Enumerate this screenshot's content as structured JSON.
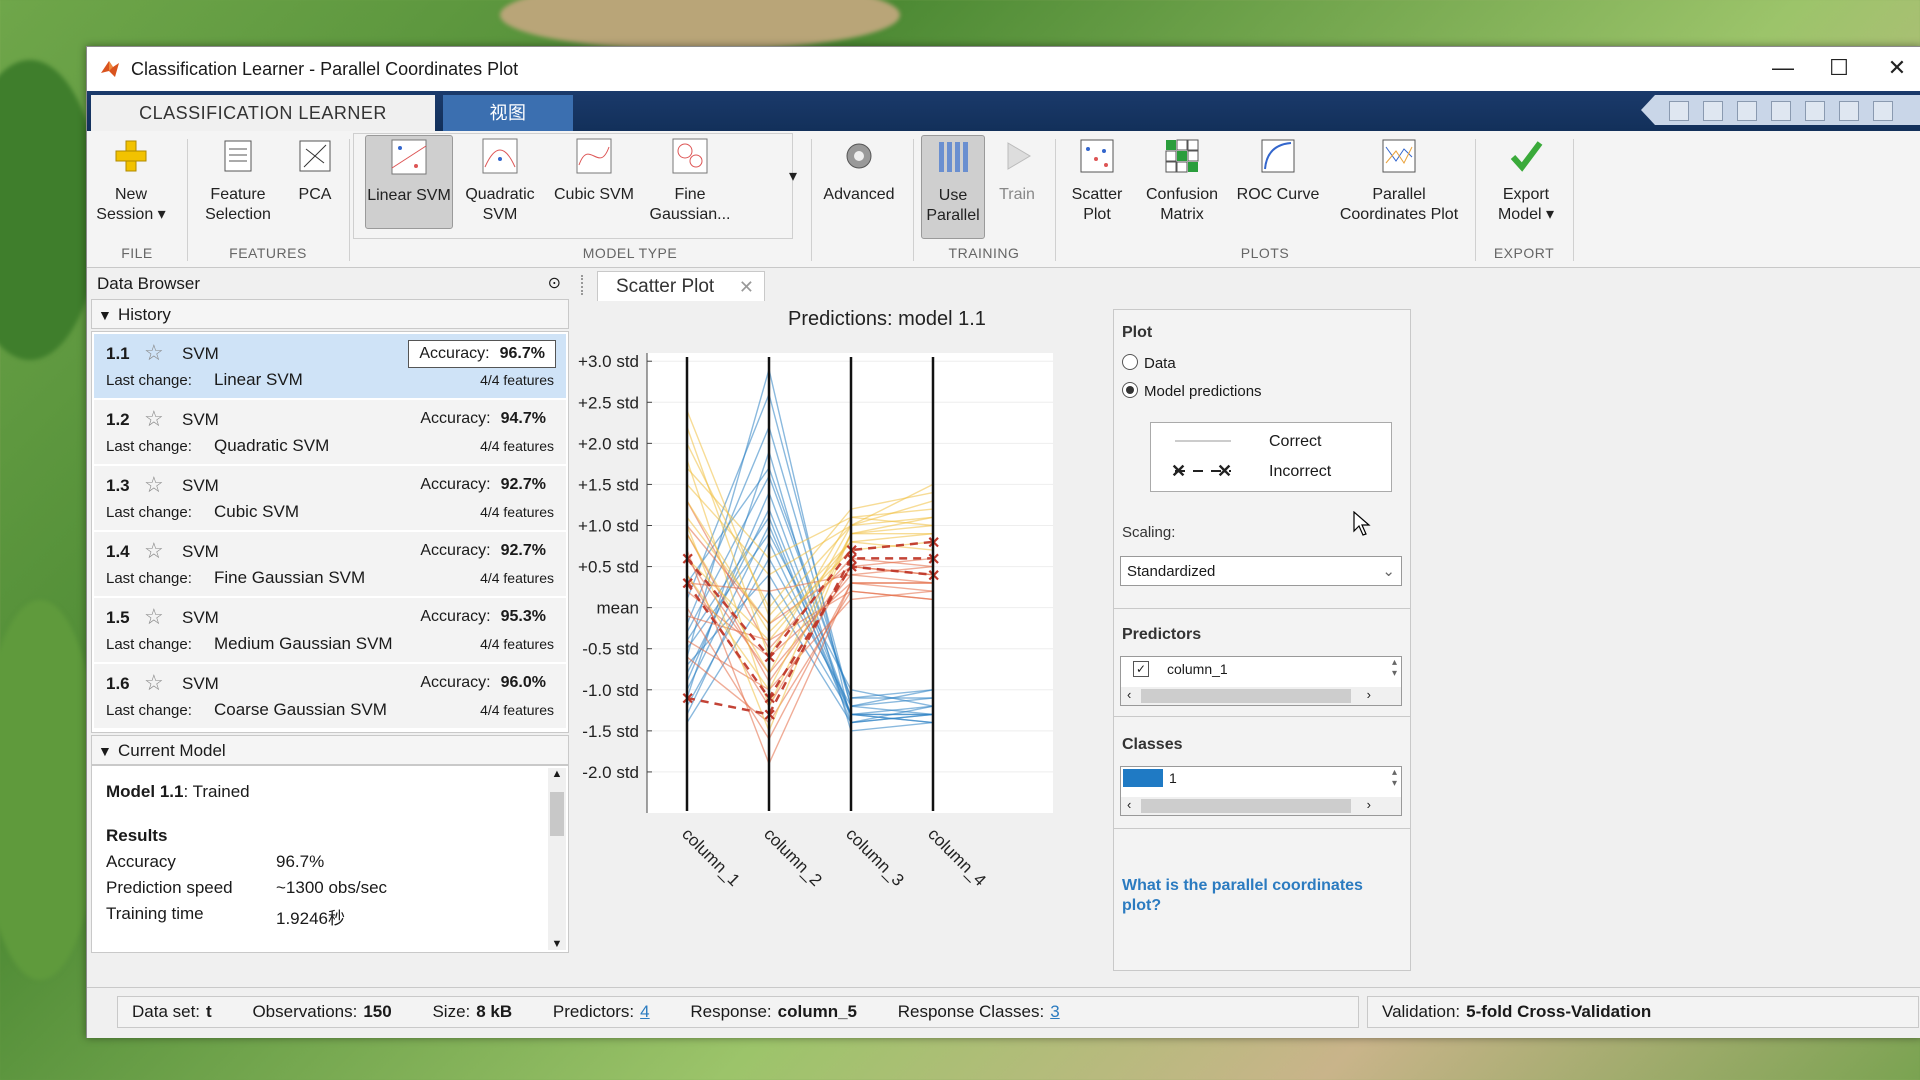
{
  "window": {
    "title": "Classification Learner - Parallel Coordinates Plot"
  },
  "ribbon_tabs": {
    "active": "CLASSIFICATION LEARNER",
    "inactive": "视图"
  },
  "ribbon": {
    "new_session": [
      "New",
      "Session"
    ],
    "feature_selection": [
      "Feature",
      "Selection"
    ],
    "pca": "PCA",
    "linear_svm": "Linear SVM",
    "quadratic_svm": [
      "Quadratic",
      "SVM"
    ],
    "cubic_svm": "Cubic SVM",
    "fine_gaussian": [
      "Fine",
      "Gaussian..."
    ],
    "advanced": "Advanced",
    "use_parallel": [
      "Use",
      "Parallel"
    ],
    "train": "Train",
    "scatter_plot": [
      "Scatter",
      "Plot"
    ],
    "confusion_matrix": [
      "Confusion",
      "Matrix"
    ],
    "roc_curve": "ROC Curve",
    "parallel_coords": [
      "Parallel",
      "Coordinates Plot"
    ],
    "export_model": [
      "Export",
      "Model"
    ],
    "groups": {
      "file": "FILE",
      "features": "FEATURES",
      "model_type": "MODEL TYPE",
      "training": "TRAINING",
      "plots": "PLOTS",
      "export": "EXPORT"
    }
  },
  "data_browser": {
    "title": "Data Browser",
    "history_label": "History",
    "current_model_label": "Current Model"
  },
  "history": [
    {
      "num": "1.1",
      "type": "SVM",
      "acc_label": "Accuracy:",
      "acc": "96.7%",
      "lc_label": "Last change:",
      "lc": "Linear SVM",
      "features": "4/4 features"
    },
    {
      "num": "1.2",
      "type": "SVM",
      "acc_label": "Accuracy:",
      "acc": "94.7%",
      "lc_label": "Last change:",
      "lc": "Quadratic SVM",
      "features": "4/4 features"
    },
    {
      "num": "1.3",
      "type": "SVM",
      "acc_label": "Accuracy:",
      "acc": "92.7%",
      "lc_label": "Last change:",
      "lc": "Cubic SVM",
      "features": "4/4 features"
    },
    {
      "num": "1.4",
      "type": "SVM",
      "acc_label": "Accuracy:",
      "acc": "92.7%",
      "lc_label": "Last change:",
      "lc": "Fine Gaussian SVM",
      "features": "4/4 features"
    },
    {
      "num": "1.5",
      "type": "SVM",
      "acc_label": "Accuracy:",
      "acc": "95.3%",
      "lc_label": "Last change:",
      "lc": "Medium Gaussian SVM",
      "features": "4/4 features"
    },
    {
      "num": "1.6",
      "type": "SVM",
      "acc_label": "Accuracy:",
      "acc": "96.0%",
      "lc_label": "Last change:",
      "lc": "Coarse Gaussian SVM",
      "features": "4/4 features"
    }
  ],
  "current_model": {
    "model_name": "Model 1.1",
    "model_status": ": Trained",
    "results_label": "Results",
    "rows": [
      {
        "k": "Accuracy",
        "v": "96.7%"
      },
      {
        "k": "Prediction speed",
        "v": "~1300 obs/sec"
      },
      {
        "k": "Training time",
        "v": "1.9246秒"
      }
    ]
  },
  "doc_tab": "Scatter Plot",
  "options": {
    "plot_label": "Plot",
    "radio_data": "Data",
    "radio_predictions": "Model predictions",
    "legend_correct": "Correct",
    "legend_incorrect": "Incorrect",
    "scaling_label": "Scaling:",
    "scaling_value": "Standardized",
    "predictors_label": "Predictors",
    "predictor_item": "column_1",
    "classes_label": "Classes",
    "class_item": "1",
    "help_link": "What is the parallel coordinates plot?"
  },
  "status": {
    "dataset_label": "Data set:",
    "dataset": "t",
    "obs_label": "Observations:",
    "obs": "150",
    "size_label": "Size:",
    "size": "8 kB",
    "pred_label": "Predictors:",
    "pred": "4",
    "resp_label": "Response:",
    "resp": "column_5",
    "rclass_label": "Response Classes:",
    "rclass": "3",
    "validation_label": "Validation:",
    "validation": "5-fold Cross-Validation"
  },
  "colors": {
    "class1": "#2a7fc2",
    "class2": "#e46a44",
    "class3": "#f0c040",
    "incorrect": "#c0392b"
  },
  "chart_data": {
    "type": "parallel_coordinates",
    "title": "Predictions: model 1.1",
    "axes": [
      "column_1",
      "column_2",
      "column_3",
      "column_4"
    ],
    "ytick_labels": [
      "+3.0 std",
      "+2.5 std",
      "+2.0 std",
      "+1.5 std",
      "+1.0 std",
      "+0.5 std",
      "mean",
      "-0.5 std",
      "-1.0 std",
      "-1.5 std",
      "-2.0 std"
    ],
    "ylim": [
      -2.5,
      3.1
    ],
    "series": [
      {
        "class": "blue",
        "color": "#2a7fc2",
        "lines": [
          [
            -1.0,
            1.0,
            -1.3,
            -1.3
          ],
          [
            -0.6,
            2.9,
            -1.4,
            -1.2
          ],
          [
            -1.2,
            0.6,
            -1.2,
            -1.3
          ],
          [
            -0.3,
            1.6,
            -1.1,
            -1.0
          ],
          [
            -0.8,
            1.2,
            -1.3,
            -1.4
          ],
          [
            -1.4,
            0.2,
            -1.4,
            -1.3
          ],
          [
            -0.2,
            2.2,
            -1.2,
            -1.1
          ],
          [
            -0.9,
            1.4,
            -1.3,
            -1.3
          ],
          [
            -0.5,
            0.9,
            -1.0,
            -1.2
          ],
          [
            -1.1,
            1.9,
            -1.5,
            -1.4
          ],
          [
            0.1,
            2.6,
            -1.2,
            -1.0
          ],
          [
            -0.7,
            0.4,
            -1.3,
            -1.2
          ],
          [
            -0.4,
            1.1,
            -1.4,
            -1.3
          ],
          [
            0.3,
            1.7,
            -1.1,
            -1.1
          ],
          [
            -1.3,
            0.8,
            -1.3,
            -1.4
          ]
        ]
      },
      {
        "class": "orange",
        "color": "#e46a44",
        "lines": [
          [
            0.2,
            -0.6,
            0.3,
            0.3
          ],
          [
            0.4,
            -1.2,
            0.5,
            0.4
          ],
          [
            -0.1,
            -0.4,
            0.2,
            0.1
          ],
          [
            0.6,
            -0.8,
            0.4,
            0.5
          ],
          [
            0.0,
            -1.6,
            0.3,
            0.2
          ],
          [
            1.0,
            -0.2,
            0.5,
            0.4
          ],
          [
            -0.4,
            -1.0,
            0.1,
            0.2
          ],
          [
            0.3,
            0.2,
            0.4,
            0.3
          ],
          [
            1.3,
            -0.5,
            0.6,
            0.5
          ],
          [
            0.7,
            -1.9,
            0.3,
            0.3
          ],
          [
            -0.6,
            -1.4,
            0.2,
            0.1
          ],
          [
            0.9,
            -0.9,
            0.5,
            0.6
          ]
        ]
      },
      {
        "class": "yellow",
        "color": "#f0c040",
        "lines": [
          [
            1.1,
            -0.2,
            0.8,
            0.9
          ],
          [
            1.5,
            0.4,
            1.0,
            1.1
          ],
          [
            2.2,
            -0.6,
            1.1,
            1.2
          ],
          [
            0.6,
            -0.4,
            0.8,
            0.7
          ],
          [
            1.8,
            -1.2,
            0.9,
            1.0
          ],
          [
            0.9,
            -0.8,
            1.0,
            1.3
          ],
          [
            2.0,
            0.0,
            1.2,
            1.4
          ],
          [
            1.3,
            -0.3,
            0.7,
            0.8
          ],
          [
            0.4,
            -1.0,
            0.9,
            0.9
          ],
          [
            1.7,
            0.6,
            1.1,
            1.0
          ],
          [
            2.4,
            -0.1,
            1.0,
            1.5
          ],
          [
            1.0,
            -1.5,
            0.9,
            1.1
          ]
        ]
      },
      {
        "class": "incorrect",
        "color": "#c0392b",
        "lines": [
          [
            -1.1,
            -1.3,
            0.6,
            0.6
          ],
          [
            0.6,
            -0.6,
            0.7,
            0.8
          ],
          [
            0.3,
            -1.1,
            0.5,
            0.4
          ]
        ]
      }
    ]
  }
}
